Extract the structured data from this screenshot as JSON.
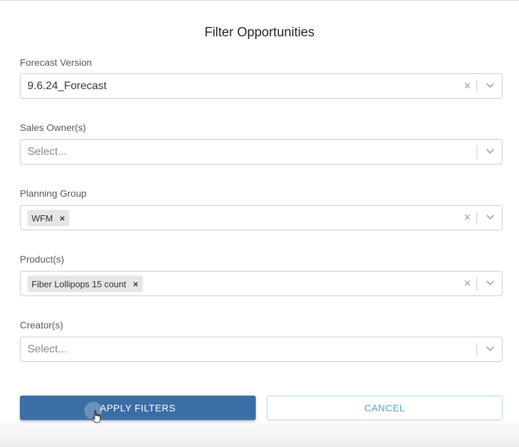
{
  "dialog": {
    "title": "Filter Opportunities"
  },
  "fields": {
    "forecast_version": {
      "label": "Forecast Version",
      "value": "9.6.24_Forecast",
      "clear_icon": "×"
    },
    "sales_owners": {
      "label": "Sales Owner(s)",
      "placeholder": "Select..."
    },
    "planning_group": {
      "label": "Planning Group",
      "chips": [
        "WFM"
      ],
      "chip_remove": "×",
      "clear_icon": "×"
    },
    "products": {
      "label": "Product(s)",
      "chips": [
        "Fiber Lollipops 15 count"
      ],
      "chip_remove": "×",
      "clear_icon": "×"
    },
    "creators": {
      "label": "Creator(s)",
      "placeholder": "Select..."
    }
  },
  "buttons": {
    "apply": "APPLY FILTERS",
    "cancel": "CANCEL"
  },
  "colors": {
    "primary": "#3a6ea5",
    "cancel_text": "#4a9fd0",
    "cancel_border": "#a8d2ec"
  },
  "icons": [
    "clear-icon",
    "chevron-down-icon",
    "chip-remove-icon",
    "hand-cursor-icon"
  ]
}
